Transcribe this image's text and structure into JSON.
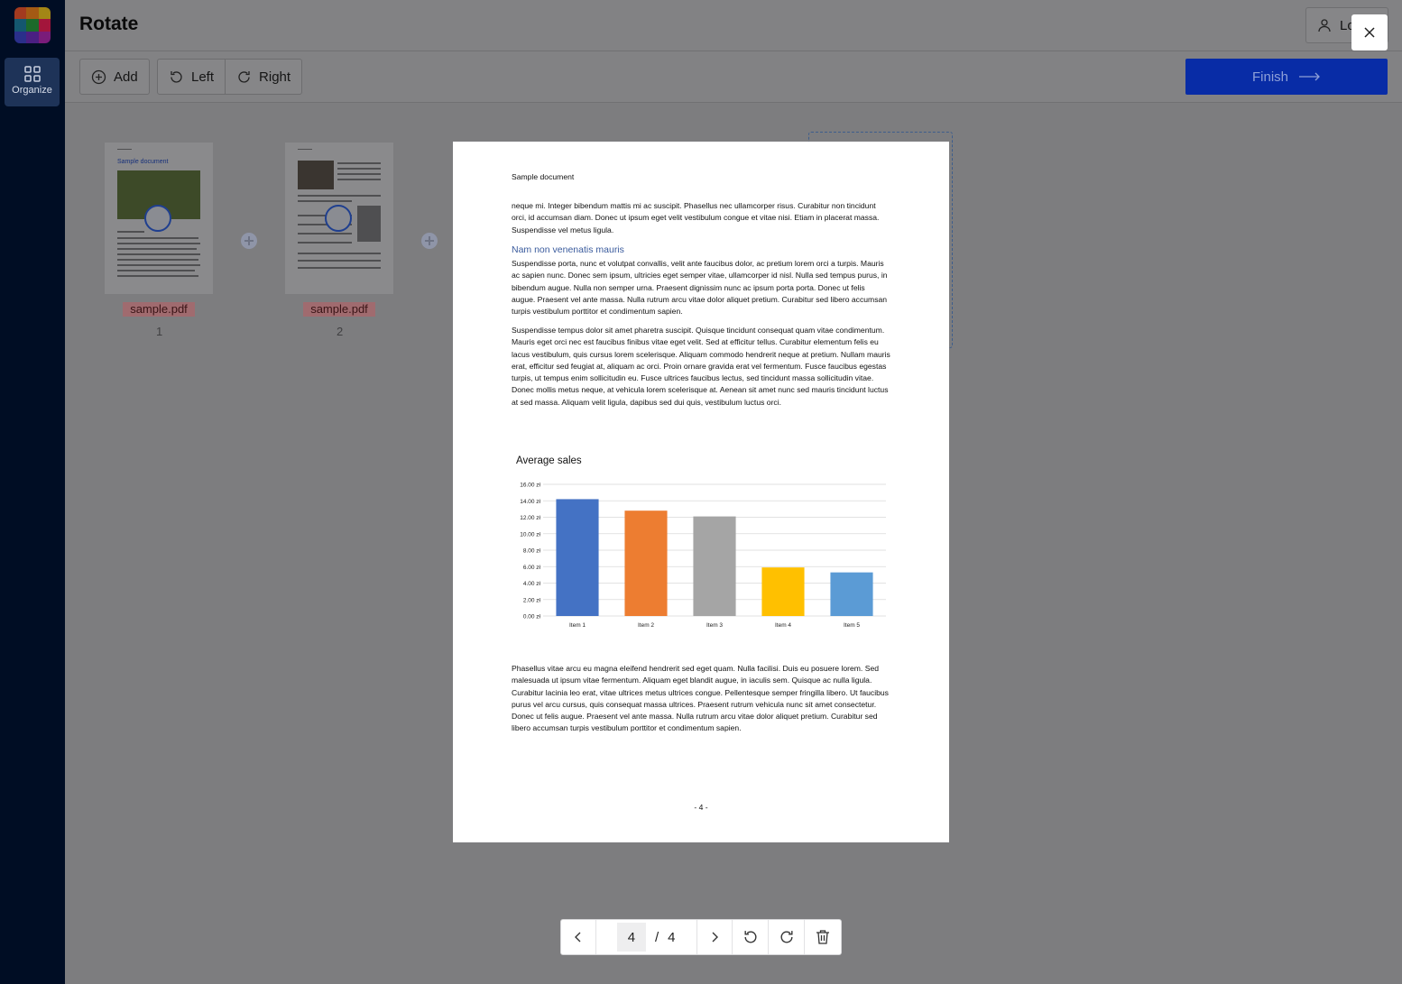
{
  "app": {
    "title": "Rotate",
    "login_label": "Lo",
    "sidebar": {
      "organize_label": "Organize"
    }
  },
  "toolbar": {
    "add_label": "Add",
    "left_label": "Left",
    "right_label": "Right",
    "finish_label": "Finish"
  },
  "thumbnails": [
    {
      "file": "sample.pdf",
      "page": "1",
      "heading": "Sample document"
    },
    {
      "file": "sample.pdf",
      "page": "2"
    }
  ],
  "preview": {
    "header": "Sample document",
    "para1": "neque mi. Integer bibendum mattis mi ac suscipit. Phasellus nec ullamcorper risus. Curabitur non tincidunt orci, id accumsan diam. Donec ut ipsum eget velit vestibulum congue et vitae nisi. Etiam in placerat massa. Suspendisse vel metus ligula.",
    "heading": "Nam non venenatis mauris",
    "para2": "Suspendisse porta, nunc et volutpat convallis, velit ante faucibus dolor, ac pretium lorem orci a turpis. Mauris ac sapien nunc. Donec sem ipsum, ultricies eget semper vitae, ullamcorper id nisl. Nulla sed tempus purus, in bibendum augue. Nulla non semper urna. Praesent dignissim nunc ac ipsum porta porta. Donec ut felis augue. Praesent vel ante massa. Nulla rutrum arcu vitae dolor aliquet pretium. Curabitur sed libero accumsan turpis vestibulum porttitor et condimentum sapien.",
    "para3": "Suspendisse tempus dolor sit amet pharetra suscipit. Quisque tincidunt consequat quam vitae condimentum. Mauris eget orci nec est faucibus finibus vitae eget velit. Sed at efficitur tellus. Curabitur elementum felis eu lacus vestibulum, quis cursus lorem scelerisque. Aliquam commodo hendrerit neque at pretium. Nullam mauris erat, efficitur sed feugiat at, aliquam ac orci. Proin ornare gravida erat vel fermentum. Fusce faucibus egestas turpis, ut tempus enim sollicitudin eu. Fusce ultrices faucibus lectus, sed tincidunt massa sollicitudin vitae. Donec mollis metus neque, at vehicula lorem scelerisque at. Aenean sit amet nunc sed mauris tincidunt luctus at sed massa. Aliquam velit ligula, dapibus sed dui quis, vestibulum luctus orci.",
    "para4": "Phasellus vitae arcu eu magna eleifend hendrerit sed eget quam. Nulla facilisi. Duis eu posuere lorem. Sed malesuada ut ipsum vitae fermentum. Aliquam eget blandit augue, in iaculis sem. Quisque ac nulla ligula. Curabitur lacinia leo erat, vitae ultrices metus ultrices congue. Pellentesque semper fringilla libero. Ut faucibus purus vel arcu cursus, quis consequat massa ultrices. Praesent rutrum vehicula nunc sit amet consectetur. Donec ut felis augue. Praesent vel ante massa. Nulla rutrum arcu vitae dolor aliquet pretium. Curabitur sed libero accumsan turpis vestibulum porttitor et condimentum sapien.",
    "page_label": "- 4 -"
  },
  "chart_data": {
    "type": "bar",
    "title": "Average sales",
    "categories": [
      "Item 1",
      "Item 2",
      "Item 3",
      "Item 4",
      "Item 5"
    ],
    "values": [
      14.2,
      12.8,
      12.1,
      5.9,
      5.3
    ],
    "colors": [
      "#4472c4",
      "#ed7d31",
      "#a5a5a5",
      "#ffc000",
      "#5b9bd5"
    ],
    "yticks": [
      "0.00 zł",
      "2.00 zł",
      "4.00 zł",
      "6.00 zł",
      "8.00 zł",
      "10.00 zł",
      "12.00 zł",
      "14.00 zł",
      "16.00 zł"
    ],
    "ylim": [
      0,
      16
    ],
    "grid": true
  },
  "pager": {
    "current": "4",
    "separator": "/",
    "total": "4"
  }
}
